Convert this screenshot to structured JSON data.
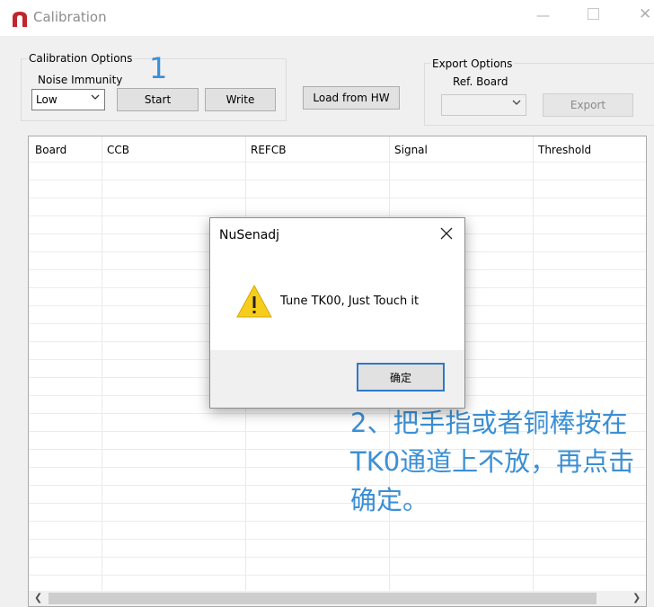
{
  "window": {
    "title": "Calibration",
    "accent_color": "#c0262c"
  },
  "calibration_options": {
    "legend": "Calibration Options",
    "noise_label": "Noise Immunity",
    "noise_value": "Low",
    "start_label": "Start",
    "write_label": "Write"
  },
  "load_hw_label": "Load from HW",
  "export_options": {
    "legend": "Export Options",
    "ref_label": "Ref. Board",
    "ref_value": "",
    "export_label": "Export"
  },
  "table": {
    "columns": [
      "Board",
      "CCB",
      "REFCB",
      "Signal",
      "Threshold"
    ],
    "rows": []
  },
  "annotations": {
    "step1": "1",
    "step2": "2、把手指或者铜棒按在TK0通道上不放，再点击确定。",
    "color": "#3b8fd4"
  },
  "dialog": {
    "title": "NuSenadj",
    "message": "Tune TK00, Just Touch it",
    "ok_label": "确定",
    "icon": "warning-icon"
  }
}
